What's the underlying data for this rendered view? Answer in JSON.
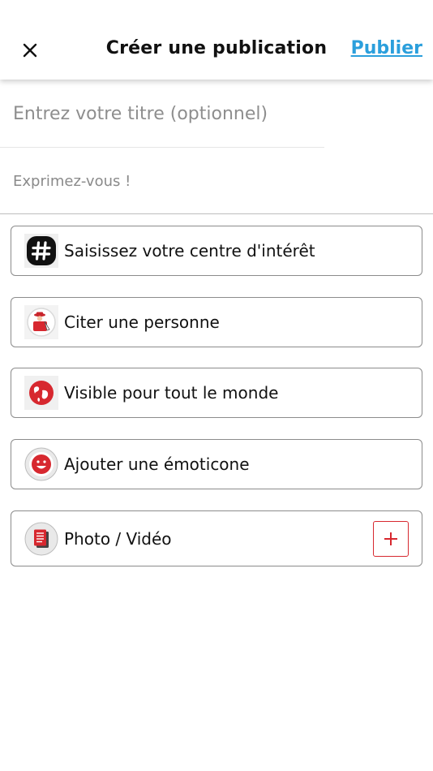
{
  "header": {
    "title": "Créer une publication",
    "publish_label": "Publier",
    "close_icon": "close-icon"
  },
  "form": {
    "title_placeholder": "Entrez votre titre (optionnel)",
    "title_value": "",
    "body_placeholder": "Exprimez-vous !",
    "body_value": ""
  },
  "options": [
    {
      "label": "Saisissez votre centre d'intérêt",
      "icon": "hashtag-icon"
    },
    {
      "label": "Citer une personne",
      "icon": "person-quote-icon"
    },
    {
      "label": "Visible pour tout le monde",
      "icon": "globe-icon"
    },
    {
      "label": "Ajouter une émoticone",
      "icon": "smiley-icon"
    },
    {
      "label": "Photo / Vidéo",
      "icon": "media-icon",
      "action_icon": "plus-icon"
    }
  ],
  "colors": {
    "accent": "#2b9fdc",
    "brand_red": "#d7282f",
    "border": "#8c8c8c",
    "placeholder": "#8e8e8e"
  }
}
